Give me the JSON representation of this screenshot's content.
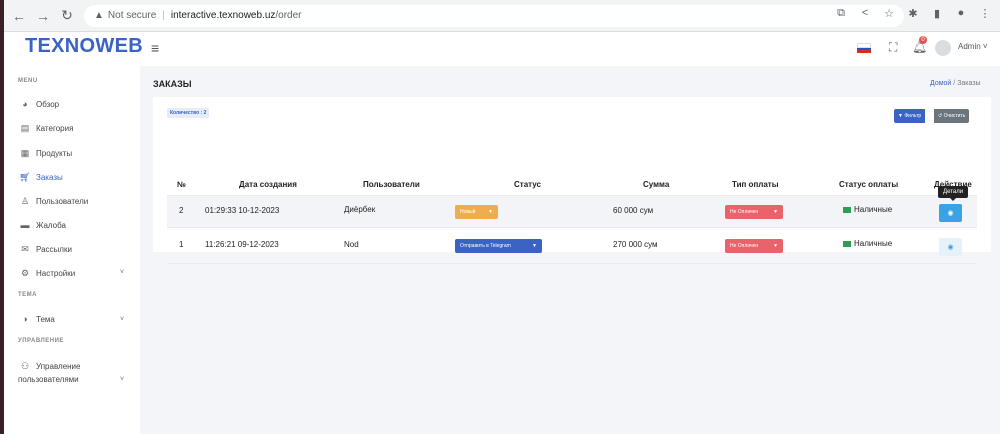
{
  "browser": {
    "not_secure": "Not secure",
    "host": "interactive.texnoweb.uz",
    "path": "/order"
  },
  "header": {
    "logo": "TEXNOWEB",
    "notification_count": "0",
    "user": "Admin"
  },
  "sidebar": {
    "menu_label": "MENU",
    "items": [
      {
        "label": "Обзор",
        "icon": "chart-pie-icon"
      },
      {
        "label": "Категория",
        "icon": "category-icon"
      },
      {
        "label": "Продукты",
        "icon": "grid-icon"
      },
      {
        "label": "Заказы",
        "icon": "cart-icon"
      },
      {
        "label": "Пользователи",
        "icon": "user-icon"
      },
      {
        "label": "Жалоба",
        "icon": "message-icon"
      },
      {
        "label": "Рассылки",
        "icon": "mail-icon"
      },
      {
        "label": "Настройки",
        "icon": "settings-icon"
      }
    ],
    "theme_label": "ТЕМА",
    "theme_item": "Тема",
    "manage_label": "УПРАВЛЕНИЕ",
    "manage_item_line1": "Управление",
    "manage_item_line2": "пользователями"
  },
  "page": {
    "title": "ЗАКАЗЫ",
    "breadcrumb_home": "Домой",
    "breadcrumb_sep": "/",
    "breadcrumb_current": "Заказы",
    "count_badge": "Количество : 2",
    "filter_button": "Фильтр",
    "clear_button": "Очистить",
    "tooltip": "Детали"
  },
  "table": {
    "headers": [
      "№",
      "Дата создания",
      "Пользователи",
      "Статус",
      "Сумма",
      "Тип оплаты",
      "Статус оплаты",
      "Действие"
    ],
    "rows": [
      {
        "num": "2",
        "date": "01:29:33 10-12-2023",
        "user": "Диёрбек",
        "status": "Новый",
        "sum": "60 000 сум",
        "payment_type": "Не Оплачен",
        "payment_status": "Наличные"
      },
      {
        "num": "1",
        "date": "11:26:21 09-12-2023",
        "user": "Nod",
        "status": "Отправить в Telegram",
        "sum": "270 000 сум",
        "payment_type": "Не Оплачен",
        "payment_status": "Наличные"
      }
    ]
  },
  "colors": {
    "brand": "#3a63c4",
    "status_new": "#f0ad4e",
    "status_telegram": "#3a63c4",
    "unpaid": "#e8636a",
    "details_active": "#3aa3e3"
  }
}
